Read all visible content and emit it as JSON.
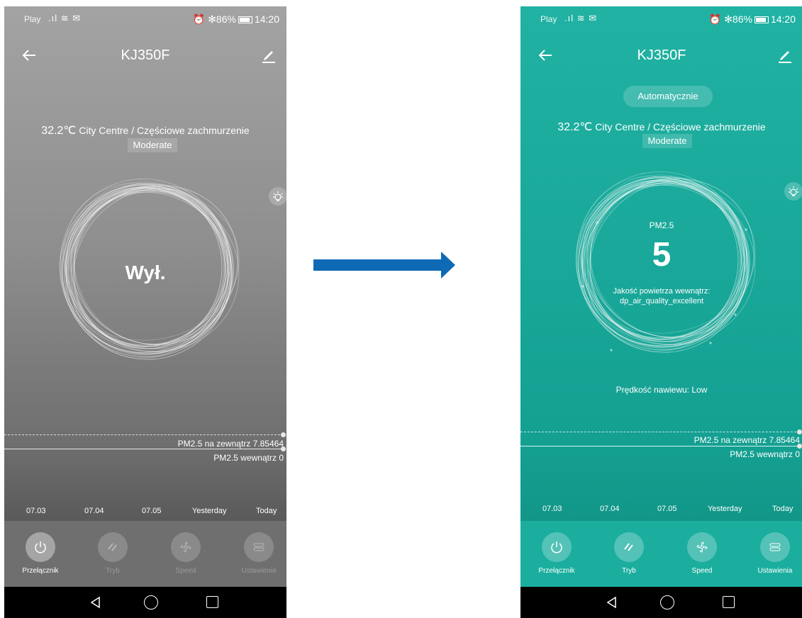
{
  "status_bar": {
    "carrier": "Play",
    "signal_icons": ".ıl ≋ ✉",
    "right_icons": "⏰ ✻86%",
    "time": "14:20"
  },
  "device": {
    "title": "KJ350F"
  },
  "weather": {
    "temperature": "32.2℃",
    "location_condition": "City Centre / Częściowe zachmurzenie",
    "quality_badge": "Moderate"
  },
  "off_screen": {
    "status_text": "Wył."
  },
  "on_screen": {
    "mode": "Automatycznie",
    "pm_label": "PM2.5",
    "pm_value": "5",
    "air_quality_line1": "Jakość powietrza wewnątrz:",
    "air_quality_line2": "dp_air_quality_excellent",
    "fan_speed": "Prędkość nawiewu: Low"
  },
  "graph": {
    "outdoor_label": "PM2.5 na zewnątrz 7.85464",
    "indoor_label": "PM2.5 wewnątrz 0",
    "dates": [
      "07.03",
      "07.04",
      "07.05",
      "Yesterday",
      "Today"
    ]
  },
  "controls": {
    "power": "Przełącznik",
    "mode": "Tryb",
    "speed": "Speed",
    "settings": "Ustawienia"
  },
  "icons": {
    "back": "arrow-left-icon",
    "edit": "pencil-icon",
    "bulb": "light-bulb-icon",
    "power": "power-icon",
    "mode": "slashes-icon",
    "speed": "fan-icon",
    "settings": "settings-bars-icon"
  },
  "colors": {
    "off_background": "#8e8e8e",
    "on_background": "#19a89a",
    "arrow": "#0e6ab5"
  }
}
